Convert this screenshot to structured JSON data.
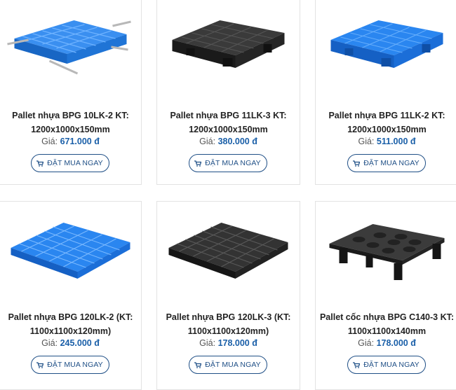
{
  "price_prefix": "Giá:",
  "buy_label": "ĐẶT MUA NGAY",
  "products": [
    {
      "name_line1": "Pallet nhựa BPG 10LK-2 KT:",
      "name_line2": "1200x1000x150mm",
      "price": "671.000 đ",
      "image": "blue-pallet-steel-rods"
    },
    {
      "name_line1": "Pallet nhựa BPG 11LK-3 KT:",
      "name_line2": "1200x1000x150mm",
      "price": "380.000 đ",
      "image": "black-pallet"
    },
    {
      "name_line1": "Pallet nhựa BPG 11LK-2 KT:",
      "name_line2": "1200x1000x150mm",
      "price": "511.000 đ",
      "image": "blue-pallet"
    },
    {
      "name_line1": "Pallet nhựa BPG 120LK-2 (KT:",
      "name_line2": "1100x1100x120mm)",
      "price": "245.000 đ",
      "image": "blue-pallet-grid"
    },
    {
      "name_line1": "Pallet nhựa BPG 120LK-3 (KT:",
      "name_line2": "1100x1100x120mm)",
      "price": "178.000 đ",
      "image": "black-pallet-grid"
    },
    {
      "name_line1": "Pallet cốc nhựa BPG C140-3 KT:",
      "name_line2": "1100x1100x140mm",
      "price": "178.000 đ",
      "image": "black-cup-pallet"
    }
  ],
  "colors": {
    "blue_pallet": "#1e7fe0",
    "black_pallet": "#2a2a2a",
    "button_border": "#1f4f86",
    "price": "#1a5fa8"
  }
}
